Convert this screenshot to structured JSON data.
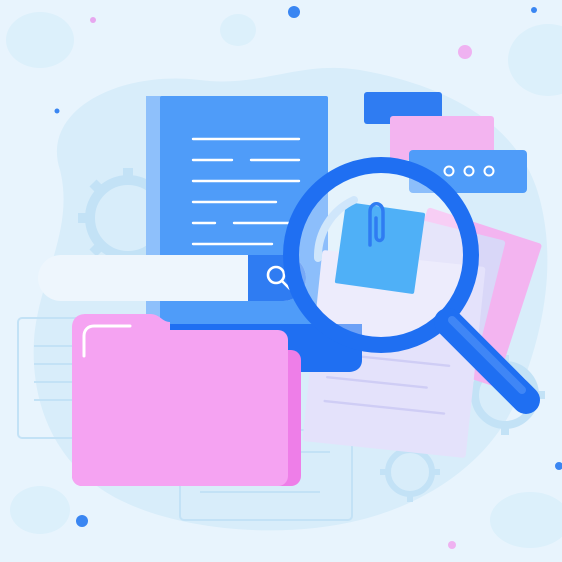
{
  "illustration": {
    "search_icon": "search-icon",
    "dialog_icon": "ellipsis-icon",
    "paperclip_icon": "paperclip-icon",
    "gear_icon": "gear-icon"
  },
  "colors": {
    "background": "#e8f4fd",
    "blob": "#d8edfa",
    "document_blue": "#4f9cf9",
    "document_blue_dark": "#2f7cf2",
    "accent_blue": "#1f6ff2",
    "folder_pink": "#f5a3f2",
    "folder_pink_dark": "#ee7ee8",
    "paper_lavender": "#e4e2fb",
    "search_bar": "#eef6fd"
  }
}
